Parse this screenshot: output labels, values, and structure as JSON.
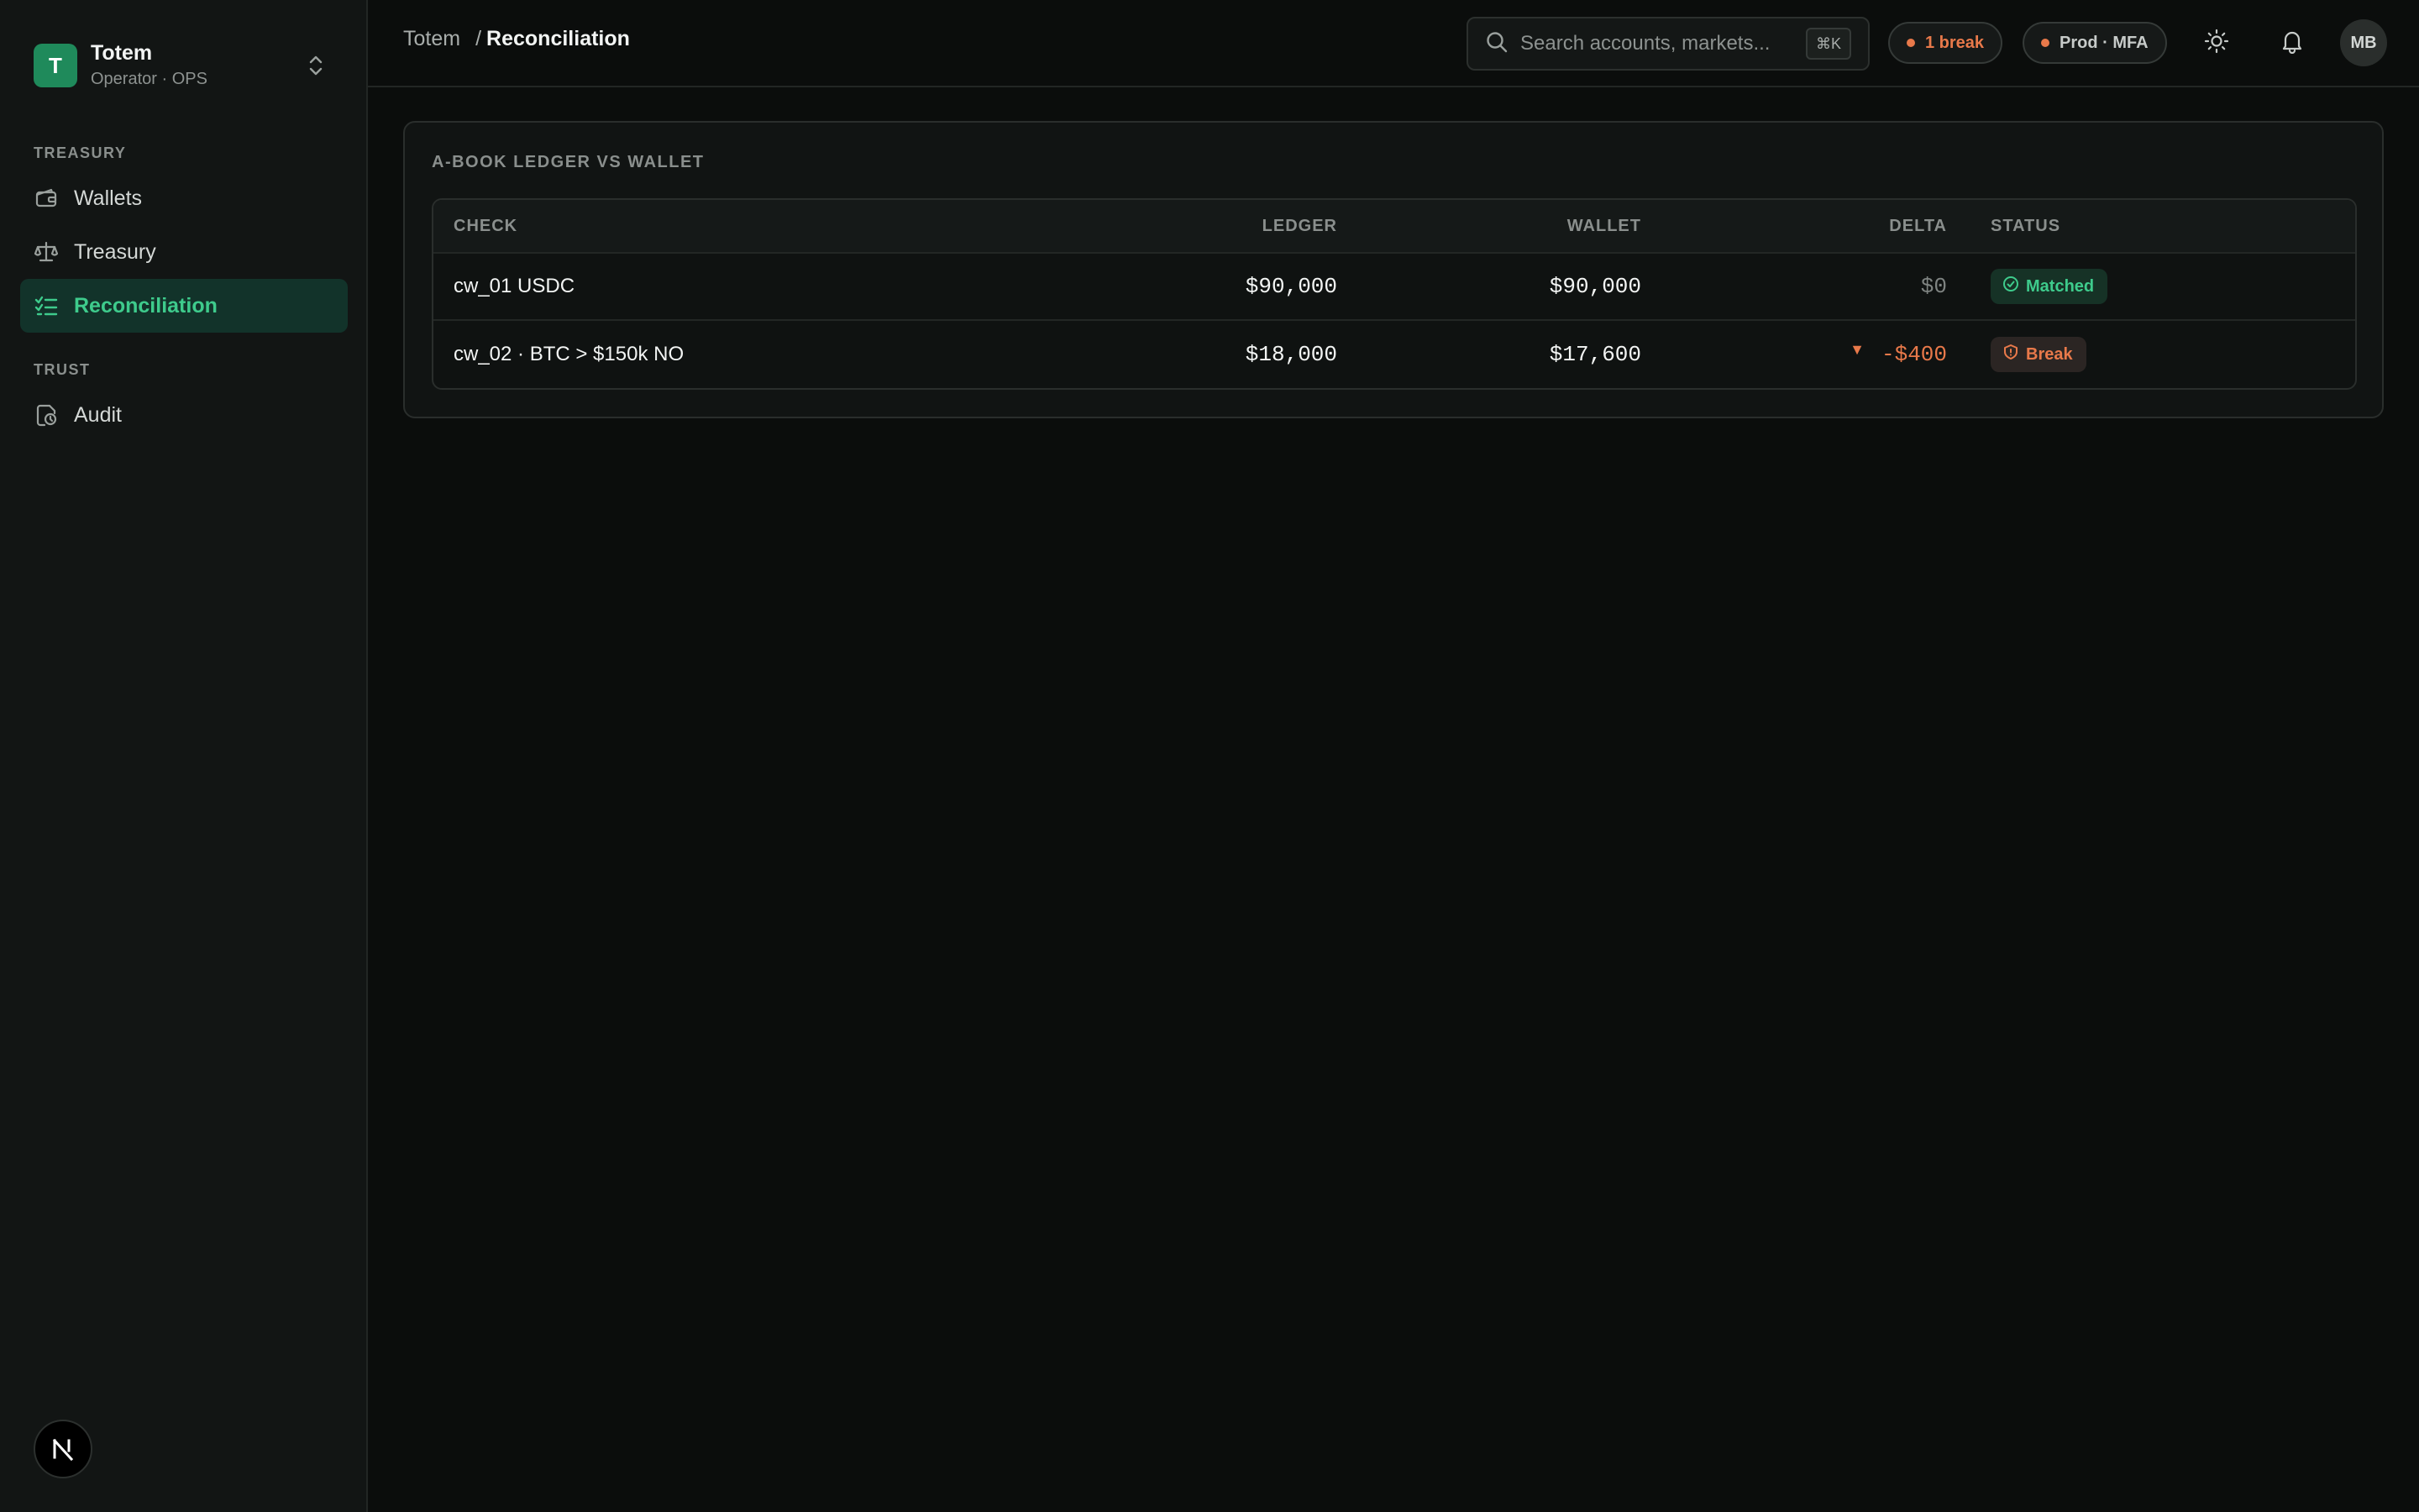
{
  "org": {
    "logo_letter": "T",
    "name": "Totem",
    "role": "Operator · OPS"
  },
  "sidebar": {
    "sections": [
      {
        "label": "TREASURY",
        "items": [
          {
            "label": "Wallets",
            "icon": "wallet-icon"
          },
          {
            "label": "Treasury",
            "icon": "scale-icon"
          },
          {
            "label": "Reconciliation",
            "icon": "checklist-icon",
            "active": true
          }
        ]
      },
      {
        "label": "TRUST",
        "items": [
          {
            "label": "Audit",
            "icon": "audit-icon"
          }
        ]
      }
    ],
    "footer_badge": "N"
  },
  "header": {
    "breadcrumb": {
      "root": "Totem",
      "separator": "/",
      "current": "Reconciliation"
    },
    "search": {
      "placeholder": "Search accounts, markets...",
      "shortcut": "⌘K"
    },
    "break_pill": "1 break",
    "env_pill": "Prod · MFA",
    "avatar_initials": "MB"
  },
  "card": {
    "title": "A-BOOK LEDGER VS WALLET",
    "columns": {
      "check": "CHECK",
      "ledger": "LEDGER",
      "wallet": "WALLET",
      "delta": "DELTA",
      "status": "STATUS"
    },
    "rows": [
      {
        "check": "cw_01 USDC",
        "ledger": "$90,000",
        "wallet": "$90,000",
        "delta": "$0",
        "status": "Matched"
      },
      {
        "check": "cw_02 · BTC > $150k NO",
        "ledger": "$18,000",
        "wallet": "$17,600",
        "delta": "-$400",
        "status": "Break"
      }
    ]
  },
  "colors": {
    "accent": "#3ecb8c",
    "logo": "#1f8a5b",
    "warning": "#e8794a",
    "background": "#0b0d0c"
  }
}
